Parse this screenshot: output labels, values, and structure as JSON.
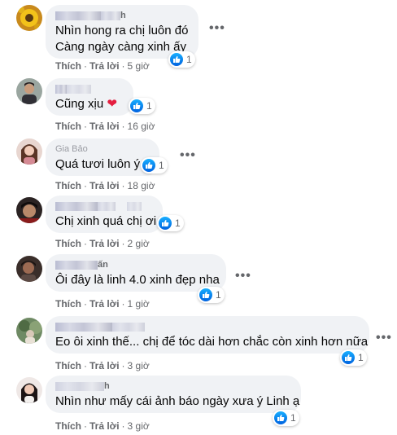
{
  "labels": {
    "like": "Thích",
    "reply": "Trả lời",
    "dot": "·",
    "more": "•••"
  },
  "colors": {
    "like_blue": "#1877f2",
    "bubble": "#f0f2f5",
    "meta": "#65676b"
  },
  "comments": [
    {
      "author_visible": "h",
      "lines": [
        "Nhìn hong ra chị luôn đó",
        "Càng ngày càng xinh ấy"
      ],
      "reactions": "1",
      "time": "5 giờ",
      "avatar_icon": "sunflower-avatar"
    },
    {
      "author_visible": "",
      "lines": [
        "Cũng xịu "
      ],
      "heart": "❤",
      "reactions": "1",
      "time": "16 giờ",
      "avatar_icon": "man-avatar"
    },
    {
      "author_visible": "Gia Bảo",
      "lines": [
        "Quá tươi luôn ý"
      ],
      "reactions": "1",
      "time": "18 giờ",
      "avatar_icon": "girl-avatar"
    },
    {
      "author_visible": "",
      "lines": [
        "Chị xinh quá chị ơi"
      ],
      "reactions": "1",
      "time": "2 giờ",
      "avatar_icon": "dark-avatar"
    },
    {
      "author_visible": "ấn",
      "lines": [
        "Ôi đây là linh 4.0 xinh đẹp nha"
      ],
      "reactions": "1",
      "time": "1 giờ",
      "avatar_icon": "night-avatar"
    },
    {
      "author_visible": "",
      "lines": [
        "Eo ôi xinh thế... chị để tóc dài hơn chắc còn xinh hơn nữa"
      ],
      "reactions": "1",
      "time": "3 giờ",
      "avatar_icon": "outdoor-avatar"
    },
    {
      "author_visible": "h",
      "lines": [
        "Nhìn như mấy cái ảnh báo ngày xưa ý Linh ạ"
      ],
      "reactions": "1",
      "time": "3 giờ",
      "avatar_icon": "woman-avatar"
    }
  ]
}
